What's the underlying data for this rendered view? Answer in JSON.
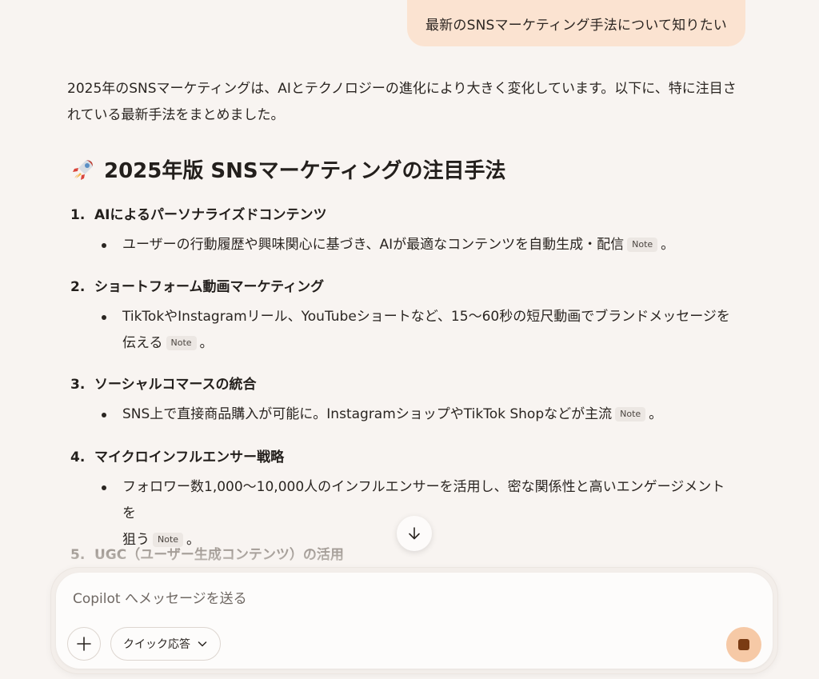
{
  "user_message": {
    "text": "最新のSNSマーケティング手法について知りたい"
  },
  "reply": {
    "intro": "2025年のSNSマーケティングは、AIとテクノロジーの進化により大きく変化しています。以下に、特に注目されている最新手法をまとめました。",
    "heading_icon": "rocket-icon",
    "heading": "2025年版 SNSマーケティングの注目手法",
    "note_label": "Note",
    "items": [
      {
        "number": "1.",
        "title": "AIによるパーソナライズドコンテンツ",
        "bullet_line1": "ユーザーの行動履歴や興味関心に基づき、AIが最適なコンテンツを自動生成・配信",
        "bullet_line2": "",
        "suffix": "。"
      },
      {
        "number": "2.",
        "title": "ショートフォーム動画マーケティング",
        "bullet_line1": "TikTokやInstagramリール、YouTubeショートなど、15〜60秒の短尺動画でブランドメッセージを",
        "bullet_line2": "伝える",
        "suffix": "。"
      },
      {
        "number": "3.",
        "title": "ソーシャルコマースの統合",
        "bullet_line1": "SNS上で直接商品購入が可能に。InstagramショップやTikTok Shopなどが主流",
        "bullet_line2": "",
        "suffix": "。"
      },
      {
        "number": "4.",
        "title": "マイクロインフルエンサー戦略",
        "bullet_line1": "フォロワー数1,000〜10,000人のインフルエンサーを活用し、密な関係性と高いエンゲージメントを",
        "bullet_line2": "狙う",
        "suffix": "。"
      },
      {
        "number": "5.",
        "title": "UGC（ユーザー生成コンテンツ）の活用"
      }
    ]
  },
  "composer": {
    "placeholder": "Copilot へメッセージを送る",
    "plus_icon": "plus-icon",
    "quick_reply_label": "クイック応答",
    "quick_reply_icon": "chevron-down-icon",
    "stop_icon": "stop-icon"
  },
  "scroll_down_icon": "arrow-down-icon",
  "colors": {
    "background": "#f8f4f1",
    "user_bubble": "#fbe3d1",
    "stop_button": "#f6c9a6",
    "stop_square": "#7a3b13",
    "text": "#2a2521"
  }
}
